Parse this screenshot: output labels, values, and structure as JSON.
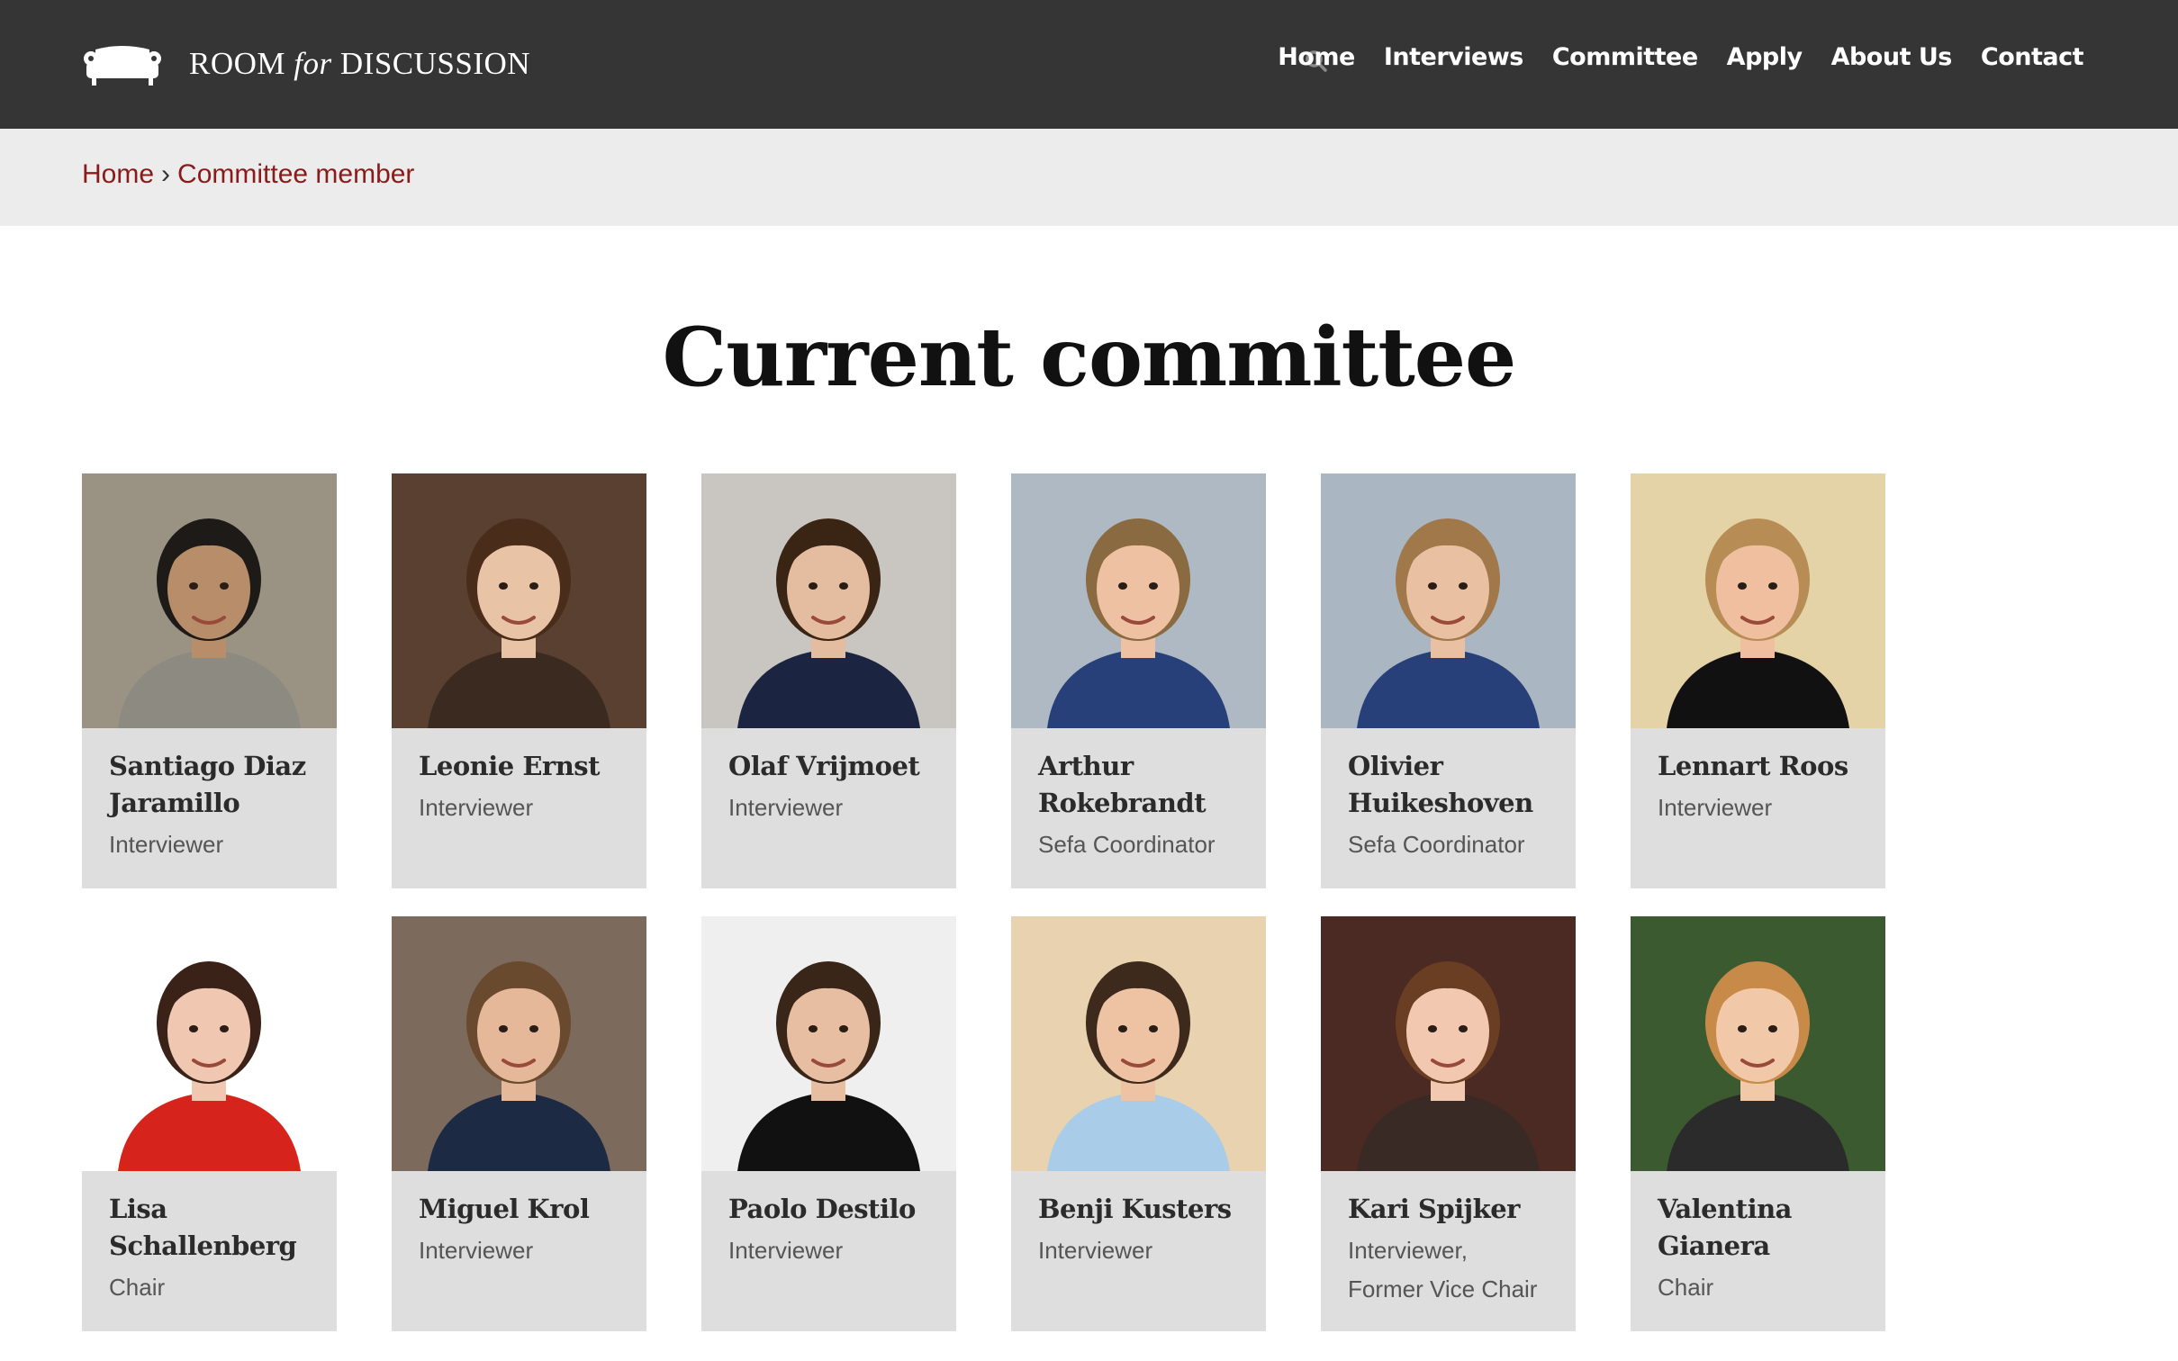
{
  "brand": {
    "text_pre": "ROOM ",
    "text_italic": "for",
    "text_post": " DISCUSSION"
  },
  "nav": [
    {
      "label": "Home",
      "name": "nav-home"
    },
    {
      "label": "Interviews",
      "name": "nav-interviews"
    },
    {
      "label": "Committee",
      "name": "nav-committee"
    },
    {
      "label": "Apply",
      "name": "nav-apply"
    },
    {
      "label": "About Us",
      "name": "nav-about-us"
    },
    {
      "label": "Contact",
      "name": "nav-contact"
    }
  ],
  "breadcrumb": {
    "home": "Home",
    "separator": "›",
    "current": "Committee member"
  },
  "page": {
    "title": "Current committee"
  },
  "members": [
    {
      "name": "Santiago Diaz Jaramillo",
      "role": "Interviewer",
      "bg": "#9a9384",
      "skin": "#b88e6a",
      "hair": "#1e1a17",
      "shirt": "#8d8a82"
    },
    {
      "name": "Leonie Ernst",
      "role": "Interviewer",
      "bg": "#5a4030",
      "skin": "#e9c3a6",
      "hair": "#4a2c1a",
      "shirt": "#3a2a20"
    },
    {
      "name": "Olaf Vrijmoet",
      "role": "Interviewer",
      "bg": "#c9c6c2",
      "skin": "#e4bca0",
      "hair": "#3a2414",
      "shirt": "#1b2440"
    },
    {
      "name": "Arthur Rokebrandt",
      "role": "Sefa Coordinator",
      "bg": "#aeb9c4",
      "skin": "#eec1a2",
      "hair": "#8a6a40",
      "shirt": "#27407a"
    },
    {
      "name": "Olivier Huikeshoven",
      "role": "Sefa Coordinator",
      "bg": "#aab6c2",
      "skin": "#eac0a3",
      "hair": "#a0784a",
      "shirt": "#27407a"
    },
    {
      "name": "Lennart Roos",
      "role": "Interviewer",
      "bg": "#e5d3a8",
      "skin": "#efbf9f",
      "hair": "#b88d55",
      "shirt": "#111111"
    },
    {
      "name": "Lisa Schallenberg",
      "role": "Chair",
      "bg": "#ffffff",
      "skin": "#f0c8b1",
      "hair": "#3b2218",
      "shirt": "#d6241c"
    },
    {
      "name": "Miguel Krol",
      "role": "Interviewer",
      "bg": "#7c6a5c",
      "skin": "#e4b898",
      "hair": "#6a4a2e",
      "shirt": "#1c2a44"
    },
    {
      "name": "Paolo Destilo",
      "role": "Interviewer",
      "bg": "#efefef",
      "skin": "#e8bea2",
      "hair": "#3a2618",
      "shirt": "#111111"
    },
    {
      "name": "Benji Kusters",
      "role": "Interviewer",
      "bg": "#e8d2b0",
      "skin": "#edc3a3",
      "hair": "#3d2a1c",
      "shirt": "#a9cde8"
    },
    {
      "name": "Kari Spijker",
      "role": "Interviewer, Former Vice Chair",
      "bg": "#4a2a22",
      "skin": "#f2c9b0",
      "hair": "#6a3e22",
      "shirt": "#3a2a25"
    },
    {
      "name": "Valentina Gianera",
      "role": "Chair",
      "bg": "#3c5a30",
      "skin": "#f1c8a8",
      "hair": "#c88a48",
      "shirt": "#2b2b2b"
    }
  ]
}
